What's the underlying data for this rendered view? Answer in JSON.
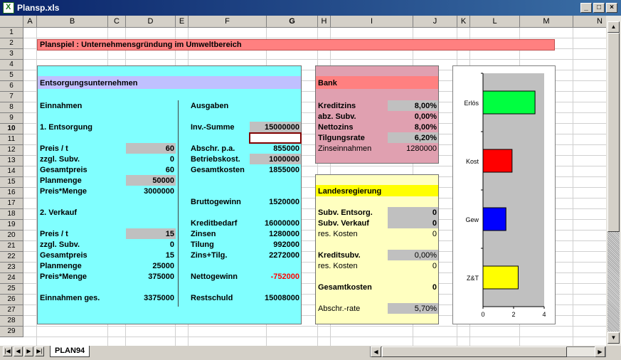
{
  "window": {
    "title": "Plansp.xls",
    "min": "_",
    "max": "□",
    "close": "×"
  },
  "columns": [
    "A",
    "B",
    "C",
    "D",
    "E",
    "F",
    "G",
    "H",
    "I",
    "J",
    "K",
    "L",
    "M",
    "N"
  ],
  "rows": [
    "1",
    "2",
    "3",
    "4",
    "5",
    "6",
    "7",
    "8",
    "9",
    "10",
    "11",
    "12",
    "13",
    "14",
    "15",
    "16",
    "17",
    "18",
    "19",
    "20",
    "21",
    "22",
    "23",
    "24",
    "25",
    "26",
    "27",
    "28",
    "29"
  ],
  "title_banner": "Planspiel : Unternehmensgründung im Umweltbereich",
  "left": {
    "header": "Entsorgungsunternehmen",
    "einnahmen": "Einnahmen",
    "ausgaben": "Ausgaben",
    "entsorgung": "1. Entsorgung",
    "verkauf": "2. Verkauf",
    "preis_t": "Preis / t",
    "preis_t_val": "60",
    "zzgl": "zzgl. Subv.",
    "zzgl_val": "0",
    "gesamtpreis": "Gesamtpreis",
    "gesamtpreis_val": "60",
    "planmenge": "Planmenge",
    "planmenge_val": "50000",
    "preis_menge": "Preis*Menge",
    "preis_menge_val": "3000000",
    "v_preis_val": "15",
    "v_zzgl_val": "0",
    "v_gesamt_val": "15",
    "v_plan_val": "25000",
    "v_pm_val": "375000",
    "einn_ges": "Einnahmen ges.",
    "einn_ges_val": "3375000",
    "inv": "Inv.-Summe",
    "inv_val": "15000000",
    "abschr": "Abschr. p.a.",
    "abschr_val": "855000",
    "betrieb": "Betriebskost.",
    "betrieb_val": "1000000",
    "gesamtk": "Gesamtkosten",
    "gesamtk_val": "1855000",
    "brutto": "Bruttogewinn",
    "brutto_val": "1520000",
    "kreditbed": "Kreditbedarf",
    "kreditbed_val": "16000000",
    "zinsen": "Zinsen",
    "zinsen_val": "1280000",
    "tilgung": "Tilung",
    "tilgung_val": "992000",
    "zt": "Zins+Tilg.",
    "zt_val": "2272000",
    "netto": "Nettogewinn",
    "netto_val": "-752000",
    "rest": "Restschuld",
    "rest_val": "15008000"
  },
  "bank": {
    "header": "Bank",
    "kreditzins": "Kreditzins",
    "kreditzins_val": "8,00%",
    "abz": "abz. Subv.",
    "abz_val": "0,00%",
    "nettozins": "Nettozins",
    "nettozins_val": "8,00%",
    "tilg": "Tilgungsrate",
    "tilg_val": "6,20%",
    "zinseinn": "Zinseinnahmen",
    "zinseinn_val": "1280000"
  },
  "land": {
    "header": "Landesregierung",
    "subv_e": "Subv. Entsorg.",
    "subv_e_val": "0",
    "subv_v": "Subv. Verkauf",
    "subv_v_val": "0",
    "res1": "res. Kosten",
    "res1_val": "0",
    "kredsubv": "Kreditsubv.",
    "kredsubv_val": "0,00%",
    "res2": "res. Kosten",
    "res2_val": "0",
    "gesk": "Gesamtkosten",
    "gesk_val": "0",
    "abschrrate": "Abschr.-rate",
    "abschrrate_val": "5,70%"
  },
  "chart_data": {
    "type": "bar",
    "orientation": "horizontal",
    "categories": [
      "Erlös",
      "Kost",
      "Gew",
      "Z&T"
    ],
    "values": [
      3.4,
      1.9,
      1.5,
      2.3
    ],
    "colors": [
      "#00ff40",
      "#ff0000",
      "#0000ff",
      "#ffff00"
    ],
    "xticks": [
      "0",
      "2",
      "4"
    ],
    "xlim": [
      0,
      4
    ]
  },
  "sheet_tab": "PLAN94"
}
